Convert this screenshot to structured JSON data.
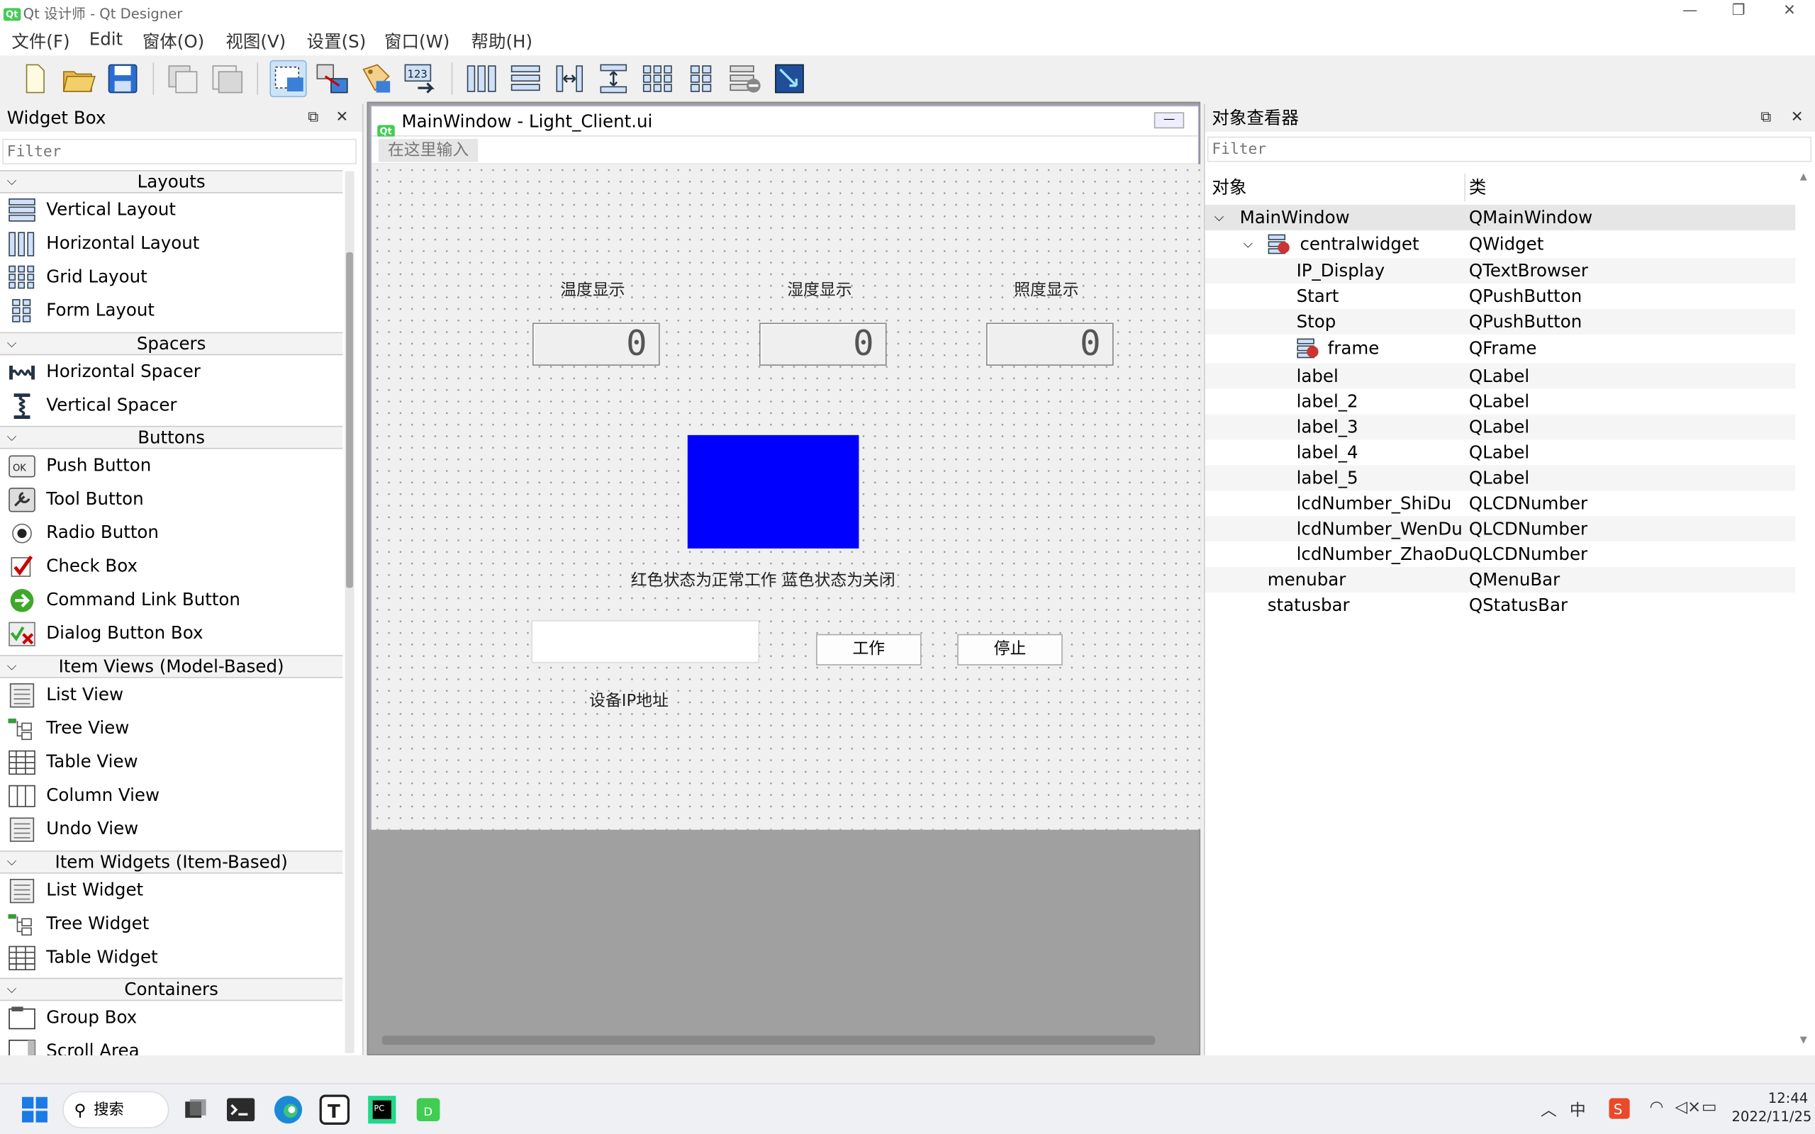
{
  "window": {
    "title": "Qt 设计师 - Qt Designer"
  },
  "menu": [
    "文件(F)",
    "Edit",
    "窗体(O)",
    "视图(V)",
    "设置(S)",
    "窗口(W)",
    "帮助(H)"
  ],
  "widget_box": {
    "title": "Widget Box",
    "filter_placeholder": "Filter",
    "categories": [
      {
        "name": "Layouts",
        "items": [
          "Vertical Layout",
          "Horizontal Layout",
          "Grid Layout",
          "Form Layout"
        ]
      },
      {
        "name": "Spacers",
        "items": [
          "Horizontal Spacer",
          "Vertical Spacer"
        ]
      },
      {
        "name": "Buttons",
        "items": [
          "Push Button",
          "Tool Button",
          "Radio Button",
          "Check Box",
          "Command Link Button",
          "Dialog Button Box"
        ]
      },
      {
        "name": "Item Views (Model-Based)",
        "items": [
          "List View",
          "Tree View",
          "Table View",
          "Column View",
          "Undo View"
        ]
      },
      {
        "name": "Item Widgets (Item-Based)",
        "items": [
          "List Widget",
          "Tree Widget",
          "Table Widget"
        ]
      },
      {
        "name": "Containers",
        "items": [
          "Group Box",
          "Scroll Area"
        ]
      }
    ]
  },
  "form": {
    "title": "MainWindow - Light_Client.ui",
    "menu_placeholder": "在这里输入",
    "labels": {
      "temp": "温度显示",
      "humidity": "湿度显示",
      "light": "照度显示",
      "status": "红色状态为正常工作  蓝色状态为关闭",
      "ip": "设备IP地址"
    },
    "lcd_values": [
      "0",
      "0",
      "0"
    ],
    "buttons": {
      "start": "工作",
      "stop": "停止"
    },
    "status_frame_color": "#0000ff"
  },
  "object_inspector": {
    "title": "对象查看器",
    "filter_placeholder": "Filter",
    "columns": [
      "对象",
      "类"
    ],
    "rows": [
      {
        "name": "MainWindow",
        "cls": "QMainWindow"
      },
      {
        "name": "centralwidget",
        "cls": "QWidget"
      },
      {
        "name": "IP_Display",
        "cls": "QTextBrowser"
      },
      {
        "name": "Start",
        "cls": "QPushButton"
      },
      {
        "name": "Stop",
        "cls": "QPushButton"
      },
      {
        "name": "frame",
        "cls": "QFrame"
      },
      {
        "name": "label",
        "cls": "QLabel"
      },
      {
        "name": "label_2",
        "cls": "QLabel"
      },
      {
        "name": "label_3",
        "cls": "QLabel"
      },
      {
        "name": "label_4",
        "cls": "QLabel"
      },
      {
        "name": "label_5",
        "cls": "QLabel"
      },
      {
        "name": "lcdNumber_ShiDu",
        "cls": "QLCDNumber"
      },
      {
        "name": "lcdNumber_WenDu",
        "cls": "QLCDNumber"
      },
      {
        "name": "lcdNumber_ZhaoDu",
        "cls": "QLCDNumber"
      },
      {
        "name": "menubar",
        "cls": "QMenuBar"
      },
      {
        "name": "statusbar",
        "cls": "QStatusBar"
      }
    ]
  },
  "taskbar": {
    "search": "搜索",
    "ime": "中",
    "time": "12:44",
    "date": "2022/11/25"
  }
}
